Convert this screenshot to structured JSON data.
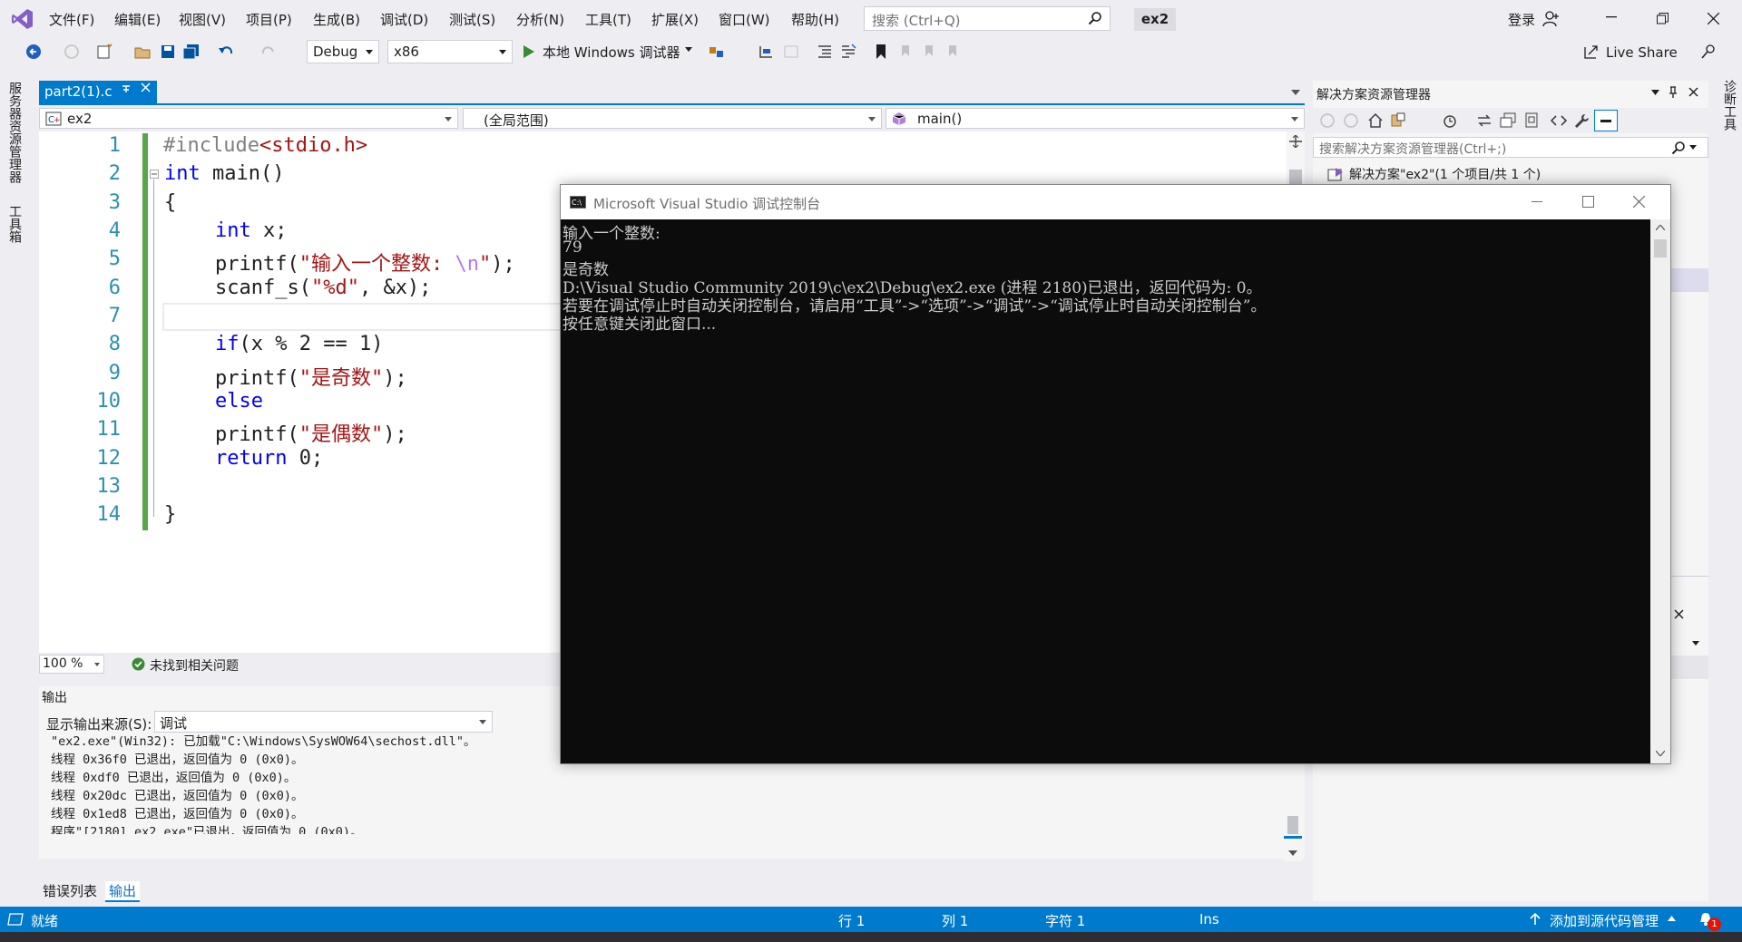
{
  "app": {
    "solution_name": "ex2",
    "login": "登录",
    "search_placeholder": "搜索 (Ctrl+Q)",
    "live_share": "Live Share"
  },
  "menu": [
    "文件(F)",
    "编辑(E)",
    "视图(V)",
    "项目(P)",
    "生成(B)",
    "调试(D)",
    "测试(S)",
    "分析(N)",
    "工具(T)",
    "扩展(X)",
    "窗口(W)",
    "帮助(H)"
  ],
  "toolbar": {
    "config": "Debug",
    "platform": "x86",
    "run_label": "本地 Windows 调试器"
  },
  "side": {
    "left_1": "服务器资源管理器",
    "left_2": "工具箱",
    "right_1": "诊断工具"
  },
  "editor": {
    "tab_label": "part2(1).c",
    "nav_project": "ex2",
    "nav_scope": "(全局范围)",
    "nav_member": "main()",
    "zoom": "100 %",
    "issues": "未找到相关问题",
    "line_numbers": [
      "1",
      "2",
      "3",
      "4",
      "5",
      "6",
      "7",
      "8",
      "9",
      "10",
      "11",
      "12",
      "13",
      "14"
    ]
  },
  "output": {
    "title": "输出",
    "source_label": "显示输出来源(S):",
    "source_value": "调试",
    "lines": [
      "\"ex2.exe\"(Win32): 已加载\"C:\\Windows\\SysWOW64\\sechost.dll\"。",
      "线程 0x36f0 已退出，返回值为 0 (0x0)。",
      "线程 0xdf0 已退出，返回值为 0 (0x0)。",
      "线程 0x20dc 已退出，返回值为 0 (0x0)。",
      "线程 0x1ed8 已退出，返回值为 0 (0x0)。",
      "程序\"[2180] ex2.exe\"已退出，返回值为 0 (0x0)。"
    ]
  },
  "bottom_tabs": [
    "错误列表",
    "输出"
  ],
  "solution_explorer": {
    "title": "解决方案资源管理器",
    "search_placeholder": "搜索解决方案资源管理器(Ctrl+;)",
    "root_node": "解决方案\"ex2\"(1 个项目/共 1 个)"
  },
  "status": {
    "ready": "就绪",
    "row": "行 1",
    "col": "列 1",
    "char": "字符 1",
    "ins": "Ins",
    "source_control": "添加到源代码管理",
    "notifications": "1"
  },
  "console": {
    "title": "Microsoft Visual Studio 调试控制台",
    "lines": [
      "输入一个整数:",
      "79",
      "是奇数",
      "D:\\Visual Studio Community 2019\\c\\ex2\\Debug\\ex2.exe (进程 2180)已退出，返回代码为: 0。",
      "若要在调试停止时自动关闭控制台，请启用“工具”->“选项”->“调试”->“调试停止时自动关闭控制台”。",
      "按任意键关闭此窗口..."
    ]
  },
  "colors": {
    "accent": "#007acc",
    "keyword": "#0000ff",
    "string": "#a31515",
    "line_number": "#2b91af",
    "console_bg": "#0c0c0c"
  }
}
